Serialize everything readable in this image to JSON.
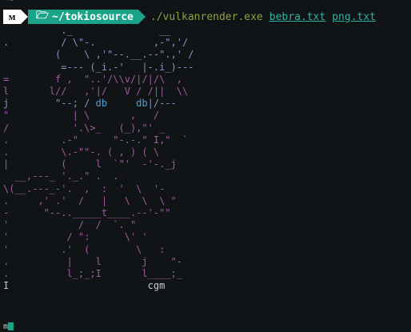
{
  "terminal": {
    "top_fragment": "~",
    "prompt": {
      "icon_label": "ᴍ",
      "directory": "~/tokiosource",
      "command": "./vulkanrender.exe",
      "args": [
        "bebra.txt",
        "png.txt"
      ]
    },
    "output_lines": [
      "          ._               __",
      ".         / \\\"-.          ,-\",'/",
      "         (    \\ ,'\"--.__.--\".,' /",
      "          =--- (_i.-'   |-.i_)---",
      "=        f ,  \"..'/\\\\v/|/|/\\  ,",
      "l       l//   ,'|/   V / /||  \\\\",
      "j        \"--; / db     db|/---",
      "\"           | \\       ,   /",
      "/           '.\\>_   (_),\"' _",
      ".         .-\"      \"-.-.\" I,\"  `",
      ".         \\.-\"\"-. ( , ) ( \\",
      "|         (     l  `\"'  -'-._j",
      "  __,---_ '._.\" .  .",
      "\\(__.---_-'.  ,  :  '  \\  '-",
      ".     ,' .'  /   |   \\  \\  \\ \"",
      "-      \"--.._____t____.--'-\"\"",
      "'            /  /  `. \"",
      "'          / \":      \\' '",
      "'         .'  (        \\   :",
      ".          |    l       j    \"-",
      ".          l_;_;I       l____;_",
      "I                        cgm"
    ],
    "status_line": "m"
  },
  "colors": {
    "background": "#111416",
    "prompt_dir_bg": "#1ba38a",
    "command": "#8f9e43",
    "args": "#32b0a0"
  }
}
